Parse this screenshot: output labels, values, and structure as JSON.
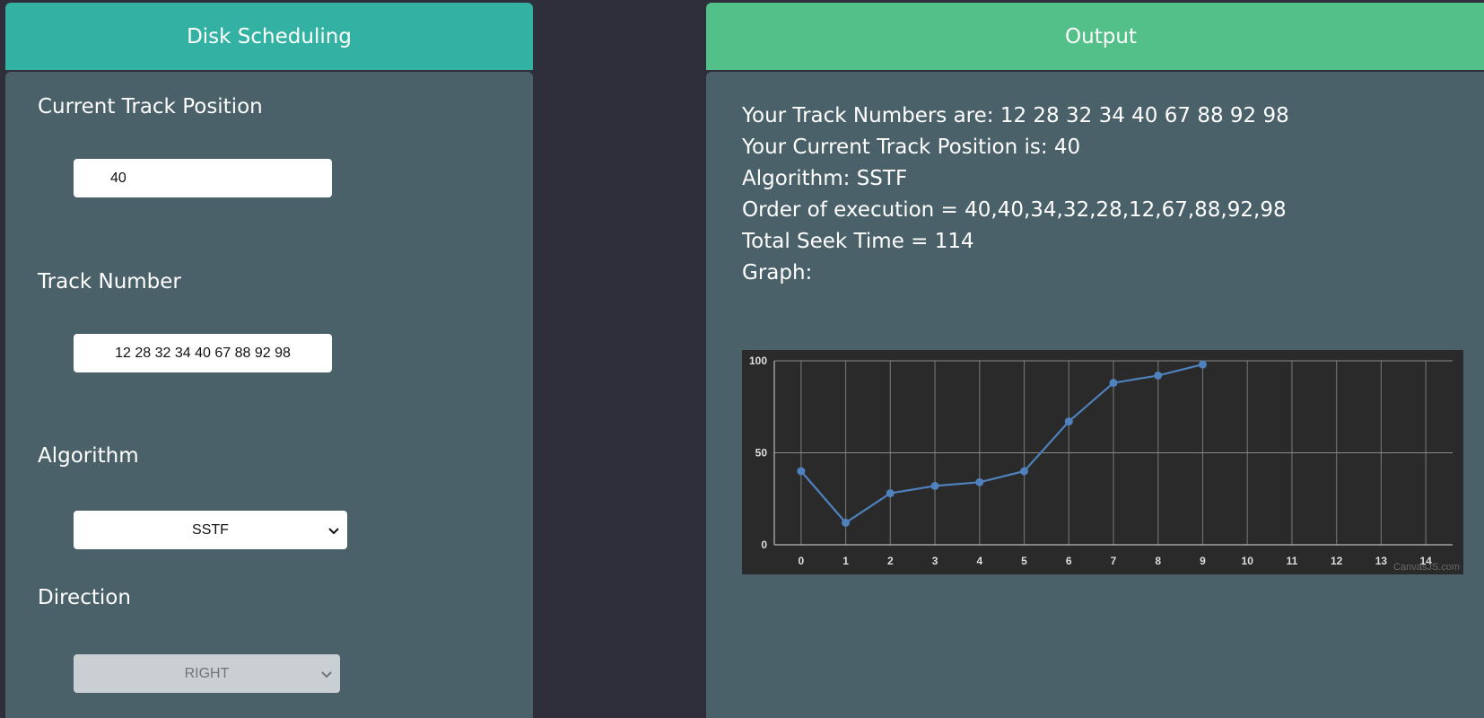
{
  "left_panel": {
    "header": "Disk Scheduling",
    "current_track": {
      "label": "Current Track Position",
      "value": "40"
    },
    "track_number": {
      "label": "Track Number",
      "value": "12 28 32 34 40 67 88 92 98"
    },
    "algorithm": {
      "label": "Algorithm",
      "selected": "SSTF"
    },
    "direction": {
      "label": "Direction",
      "selected": "RIGHT",
      "disabled": true
    }
  },
  "right_panel": {
    "header": "Output",
    "lines": {
      "tracks": "Your Track Numbers are: 12 28 32 34 40 67 88 92 98",
      "position": "Your Current Track Position is: 40",
      "algorithm": "Algorithm: SSTF",
      "order": "Order of execution = 40,40,34,32,28,12,67,88,92,98",
      "seek": "Total Seek Time = 114",
      "graph": "Graph:"
    },
    "chart_credit": "CanvasJS.com"
  },
  "colors": {
    "background": "#2e2f3b",
    "panel": "#4b6169",
    "left_header": "#33b2a3",
    "right_header": "#54c089",
    "chart_bg": "#2a2a2a",
    "series": "#4f81bc"
  },
  "chart_data": {
    "type": "line",
    "title": "",
    "xlabel": "",
    "ylabel": "",
    "x_ticks": [
      0,
      1,
      2,
      3,
      4,
      5,
      6,
      7,
      8,
      9,
      10,
      11,
      12,
      13,
      14
    ],
    "y_ticks": [
      0,
      50,
      100
    ],
    "xlim": [
      -0.6,
      14.6
    ],
    "ylim": [
      0,
      100
    ],
    "grid": true,
    "series": [
      {
        "x": [
          0,
          1,
          2,
          3,
          4,
          5,
          6,
          7,
          8,
          9
        ],
        "values": [
          40,
          12,
          28,
          32,
          34,
          40,
          67,
          88,
          92,
          98
        ]
      }
    ]
  }
}
